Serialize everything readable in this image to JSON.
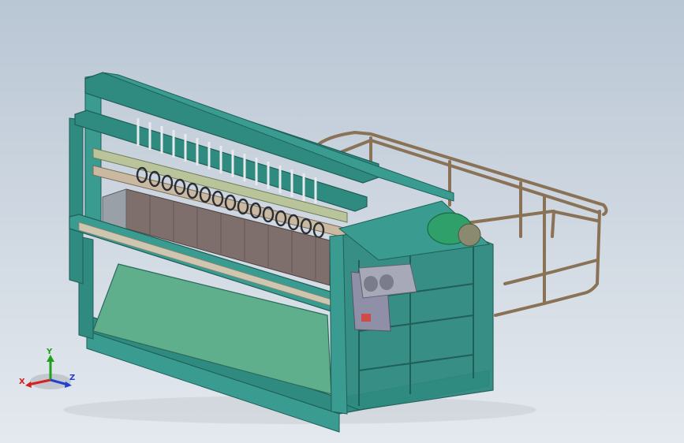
{
  "triad": {
    "x_label": "X",
    "y_label": "Y",
    "z_label": "Z",
    "x_color": "#d42020",
    "y_color": "#20a020",
    "z_color": "#2040d0"
  },
  "colors": {
    "frame": "#2f8a80",
    "frame_dark": "#1f5f58",
    "panel": "#5fae8c",
    "rail": "#8a7256",
    "spring": "#2a2d33",
    "board": "#7e6f6c"
  }
}
